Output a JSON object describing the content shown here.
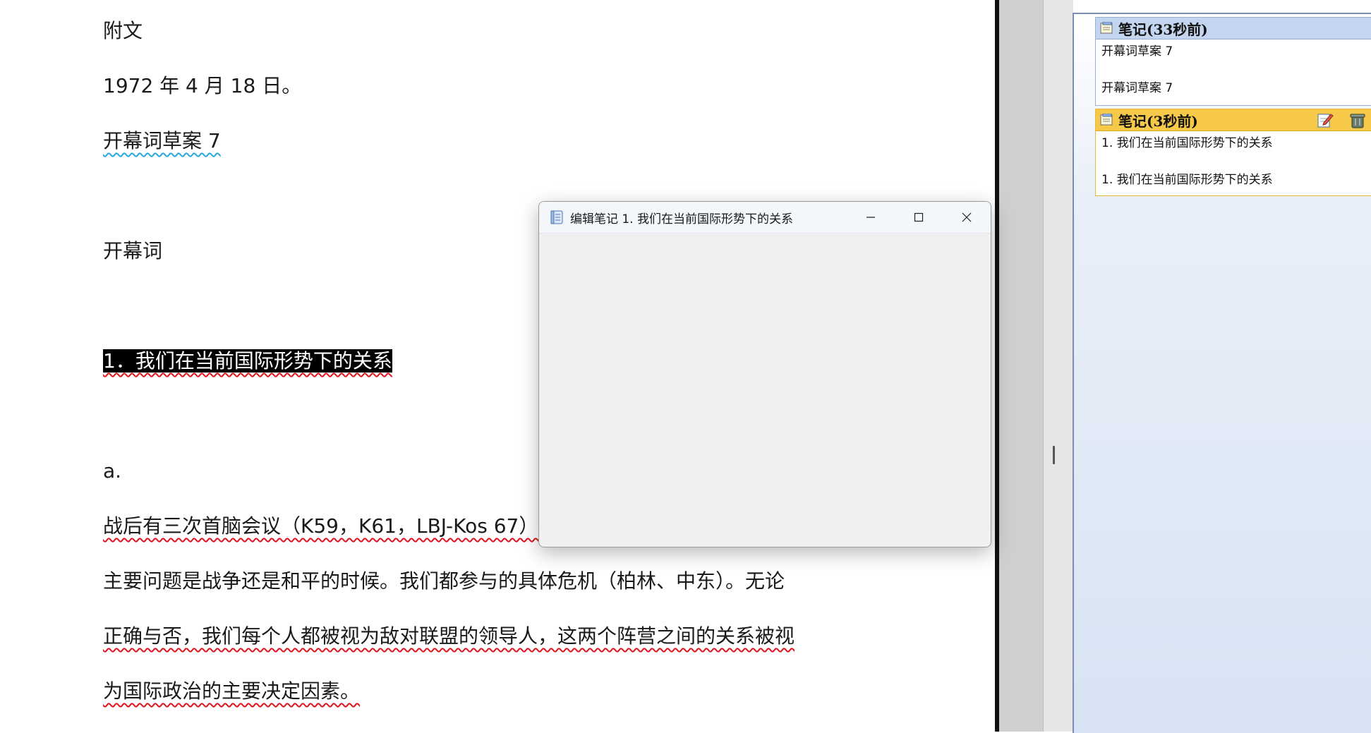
{
  "document": {
    "lines": [
      "附文",
      "1972 年 4 月 18 日。",
      "开幕词草案 7",
      "开幕词",
      "1．我们在当前国际形势下的关系",
      "a.",
      "战后有三次首脑会议（K59，K61，LBJ-Kos 67）",
      "主要问题是战争还是和平的时候。我们都参与的具体危机（柏林、中东）。无论",
      "正确与否，我们每个人都被视为敌对联盟的领导人，这两个阵营之间的关系被视",
      "为国际政治的主要决定因素。"
    ]
  },
  "dialog": {
    "title": "编辑笔记 1. 我们在当前国际形势下的关系",
    "icon": "notebook-icon",
    "buttons": [
      "minimize",
      "maximize",
      "close"
    ]
  },
  "notes_panel": {
    "notes": [
      {
        "header": "笔记(33秒前)",
        "lines": [
          "开幕词草案 7",
          "开幕词草案 7"
        ],
        "active": false
      },
      {
        "header": "笔记(3秒前)",
        "lines": [
          "1. 我们在当前国际形势下的关系",
          "1. 我们在当前国际形势下的关系"
        ],
        "active": true,
        "tools": [
          "edit-note-icon",
          "delete-note-icon"
        ]
      }
    ]
  },
  "colors": {
    "selection": "#000000",
    "spell_error": "#e0141e",
    "grammar": "#29a7e1",
    "active_note_header": "#f7c949",
    "note_header": "#c4d6ef"
  }
}
